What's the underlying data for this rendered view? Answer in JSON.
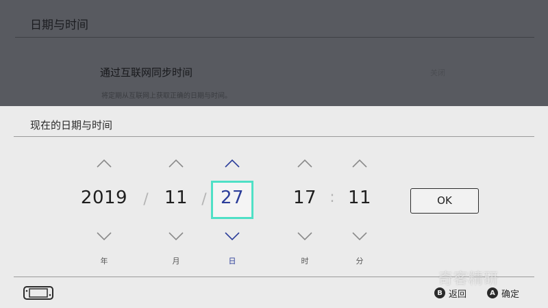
{
  "background": {
    "title": "日期与时间",
    "row_label": "通过互联网同步时间",
    "row_value": "关闭",
    "row_description": "将定期从互联网上获取正确的日期与时间。"
  },
  "dialog": {
    "title": "现在的日期与时间",
    "separators": {
      "date1": "/",
      "date2": "/",
      "time": ":"
    },
    "fields": [
      {
        "value": "2019",
        "unit": "年",
        "focused": false
      },
      {
        "value": "11",
        "unit": "月",
        "focused": false
      },
      {
        "value": "27",
        "unit": "日",
        "focused": true
      },
      {
        "value": "17",
        "unit": "时",
        "focused": false
      },
      {
        "value": "11",
        "unit": "分",
        "focused": false
      }
    ],
    "ok_label": "OK"
  },
  "footer": {
    "back_button_glyph": "B",
    "back_label": "返回",
    "confirm_button_glyph": "A",
    "confirm_label": "确定",
    "watermark": "奇客精研"
  },
  "colors": {
    "focus_border": "#4fe0c6",
    "active_text": "#2c3e9a",
    "dialog_bg": "#ebebeb",
    "backdrop": "#585a60"
  },
  "icons": {
    "up_arrow": "chevron-up-icon",
    "down_arrow": "chevron-down-icon",
    "console": "switch-console-icon"
  }
}
